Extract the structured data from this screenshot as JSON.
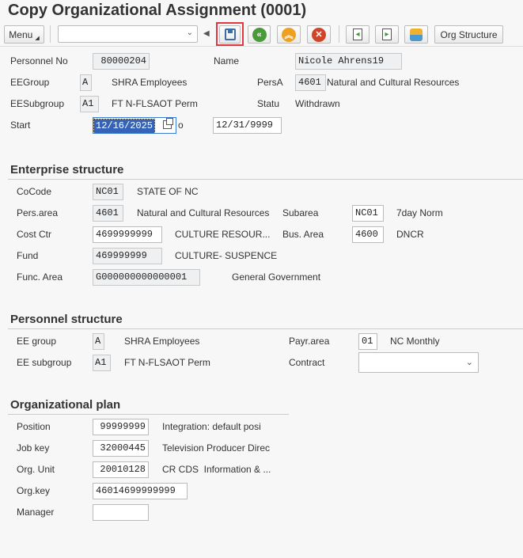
{
  "title": "Copy Organizational Assignment (0001)",
  "toolbar": {
    "menu": "Menu",
    "command_value": "",
    "org_structure": "Org Structure",
    "icons": [
      "save-icon",
      "back-icon",
      "exit-icon",
      "cancel-icon",
      "previous-record-icon",
      "next-record-icon",
      "overview-icon"
    ]
  },
  "header": {
    "personnel_no_label": "Personnel No",
    "personnel_no": "80000204",
    "name_label": "Name",
    "name": "Nicole Ahrens19",
    "eegroup_label": "EEGroup",
    "eegroup": "A",
    "eegroup_text": "SHRA Employees",
    "persa_label": "PersA",
    "persa": "4601",
    "persa_text": "Natural and Cultural Resources",
    "eesubgroup_label": "EESubgroup",
    "eesubgroup": "A1",
    "eesubgroup_text": "FT N-FLSAOT Perm",
    "status_label": "Statu",
    "status": "Withdrawn",
    "start_label": "Start",
    "start": "12/16/2025",
    "to_label": "o",
    "end": "12/31/9999"
  },
  "enterprise": {
    "heading": "Enterprise structure",
    "cocode_label": "CoCode",
    "cocode": "NC01",
    "cocode_text": "STATE OF NC",
    "persarea_label": "Pers.area",
    "persarea": "4601",
    "persarea_text": "Natural and Cultural Resources",
    "subarea_label": "Subarea",
    "subarea": "NC01",
    "subarea_text": "7day Norm",
    "costctr_label": "Cost Ctr",
    "costctr": "4699999999",
    "costctr_text": "CULTURE RESOUR...",
    "busarea_label": "Bus. Area",
    "busarea": "4600",
    "busarea_text": "DNCR",
    "fund_label": "Fund",
    "fund": "469999999",
    "fund_text": "CULTURE- SUSPENCE",
    "funcarea_label": "Func. Area",
    "funcarea": "G000000000000001",
    "funcarea_text": "General Government"
  },
  "personnel": {
    "heading": "Personnel structure",
    "eegroup_label": "EE group",
    "eegroup": "A",
    "eegroup_text": "SHRA Employees",
    "payrarea_label": "Payr.area",
    "payrarea": "01",
    "payrarea_text": "NC Monthly",
    "eesubgroup_label": "EE subgroup",
    "eesubgroup": "A1",
    "eesubgroup_text": "FT N-FLSAOT Perm",
    "contract_label": "Contract",
    "contract": ""
  },
  "orgplan": {
    "heading": "Organizational plan",
    "position_label": "Position",
    "position": "99999999",
    "position_text": "Integration: default posi",
    "jobkey_label": "Job key",
    "jobkey": "32000445",
    "jobkey_text": "Television Producer Direc",
    "orgunit_label": "Org. Unit",
    "orgunit": "20010128",
    "orgunit_text": "CR CDS  Information & ...",
    "orgkey_label": "Org.key",
    "orgkey": "46014699999999",
    "manager_label": "Manager",
    "manager": ""
  }
}
